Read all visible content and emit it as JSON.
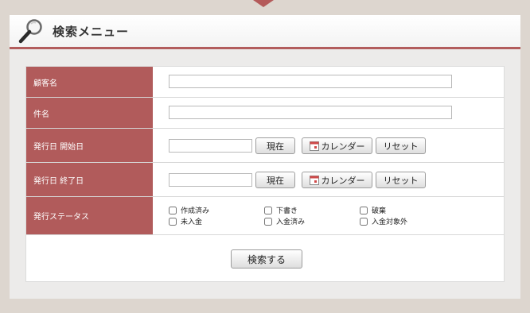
{
  "header": {
    "title": "検索メニュー"
  },
  "icons": {
    "magnifier": "search-icon",
    "calendar": "calendar-icon"
  },
  "colors": {
    "label_bg": "#b15b5b",
    "accent": "#b25d5d",
    "background": "#ddd6cf"
  },
  "fields": {
    "customer_name": {
      "label": "顧客名",
      "value": ""
    },
    "subject": {
      "label": "件名",
      "value": ""
    },
    "issue_start": {
      "label": "発行日 開始日",
      "value": ""
    },
    "issue_end": {
      "label": "発行日 終了日",
      "value": ""
    },
    "status": {
      "label": "発行ステータス"
    }
  },
  "buttons": {
    "now": "現在",
    "calendar": "カレンダー",
    "reset": "リセット",
    "search": "検索する"
  },
  "status_options": [
    "作成済み",
    "下書き",
    "破棄",
    "未入金",
    "入金済み",
    "入金対象外"
  ]
}
